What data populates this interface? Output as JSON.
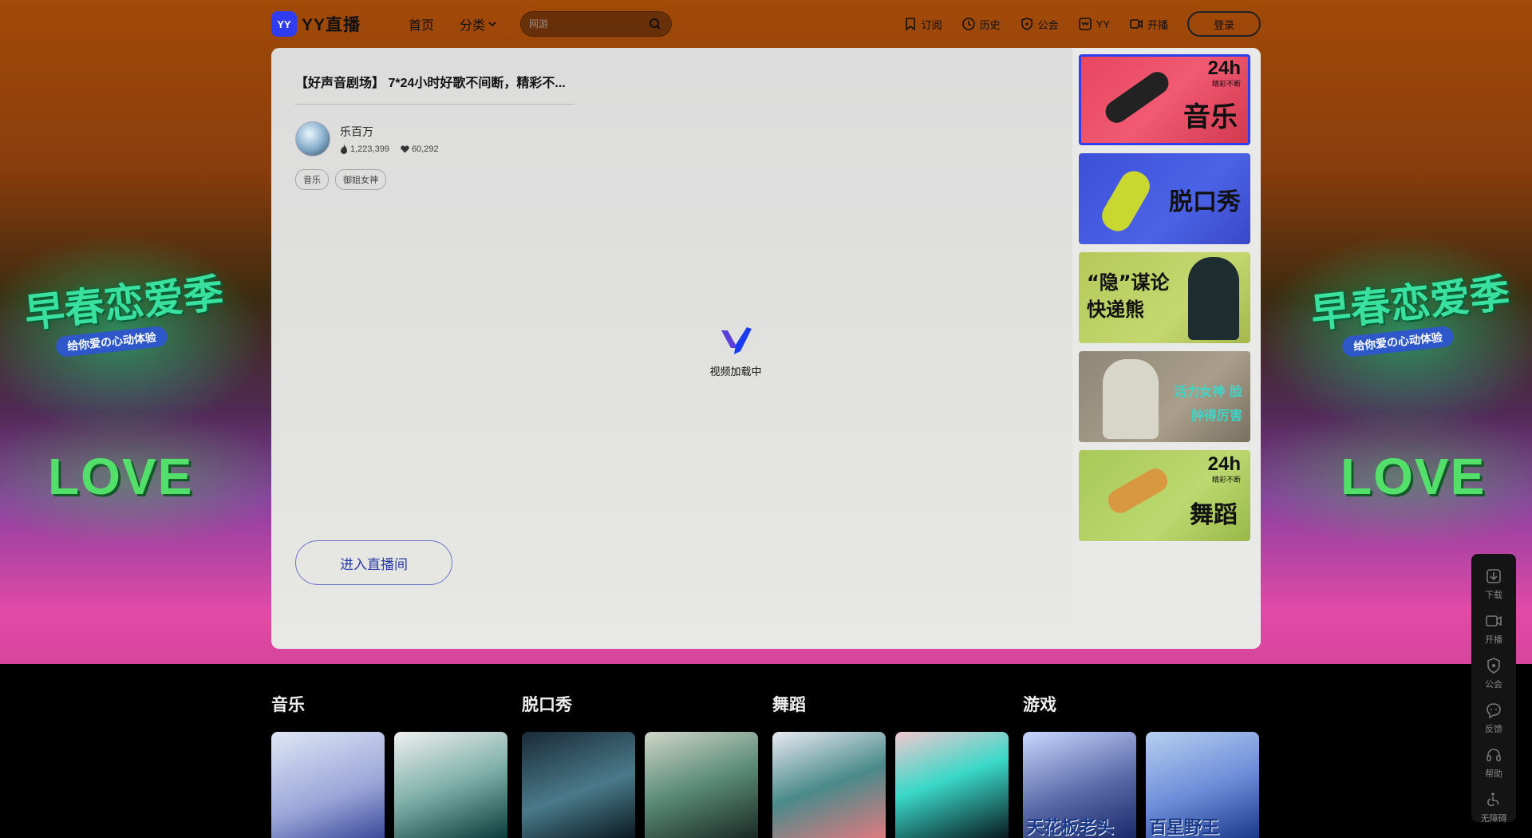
{
  "header": {
    "logo_mark": "YY",
    "logo_text": "YY直播",
    "nav_home": "首页",
    "nav_category": "分类",
    "search_placeholder": "网游",
    "links": {
      "subscribe": "订阅",
      "history": "历史",
      "guild": "公会",
      "yy": "YY",
      "broadcast": "开播"
    },
    "login": "登录"
  },
  "player": {
    "title": "【好声音剧场】 7*24小时好歌不间断，精彩不...",
    "anchor_name": "乐百万",
    "heat": "1,223,399",
    "likes": "60,292",
    "tags": [
      "音乐",
      "御姐女神"
    ],
    "loading_text": "视频加载中",
    "enter_button": "进入直播间"
  },
  "sidebar_channels": [
    {
      "label": "音乐",
      "badge_big": "24h",
      "badge_small": "精彩不断",
      "active": true
    },
    {
      "label": "脱口秀"
    },
    {
      "label": "“隐”谋论 快递熊"
    },
    {
      "label": "活力女神 脸肿得厉害"
    },
    {
      "label": "舞蹈",
      "badge_big": "24h",
      "badge_small": "精彩不断"
    }
  ],
  "hero_decor": {
    "left_title": "早春恋爱季",
    "left_sub": "给你爱の心动体验",
    "right_title": "早春恋爱季",
    "right_sub": "给你爱の心动体验",
    "love": "LOVE"
  },
  "categories": [
    {
      "title": "音乐"
    },
    {
      "title": "脱口秀"
    },
    {
      "title": "舞蹈"
    },
    {
      "title": "游戏"
    }
  ],
  "game_captions": [
    "天花板老头",
    "百星野王"
  ],
  "float_menu": [
    "下载",
    "开播",
    "公会",
    "反馈",
    "帮助",
    "无障碍"
  ],
  "colors": {
    "accent": "#2f3cf0",
    "bottom_bg": "#000000"
  }
}
